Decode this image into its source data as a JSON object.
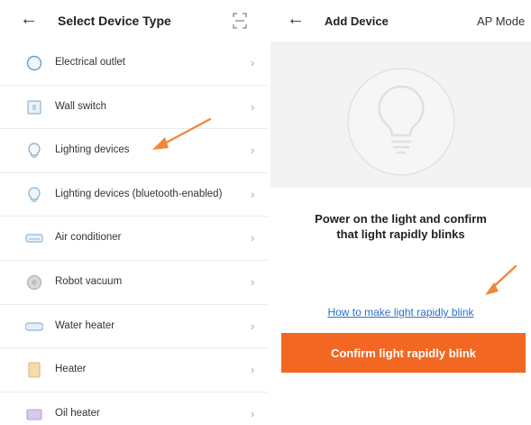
{
  "left": {
    "title": "Select Device Type",
    "items": [
      {
        "label": "Electrical outlet",
        "icon": "outlet-icon"
      },
      {
        "label": "Wall switch",
        "icon": "wall-switch-icon"
      },
      {
        "label": "Lighting devices",
        "icon": "bulb-icon"
      },
      {
        "label": "Lighting devices (bluetooth-enabled)",
        "icon": "bluetooth-bulb-icon"
      },
      {
        "label": "Air conditioner",
        "icon": "air-conditioner-icon"
      },
      {
        "label": "Robot vacuum",
        "icon": "robot-vacuum-icon"
      },
      {
        "label": "Water heater",
        "icon": "water-heater-icon"
      },
      {
        "label": "Heater",
        "icon": "heater-icon"
      },
      {
        "label": "Oil heater",
        "icon": "oil-heater-icon"
      }
    ]
  },
  "right": {
    "title": "Add Device",
    "mode": "AP Mode",
    "instruction_line1": "Power on the light and confirm",
    "instruction_line2": "that light rapidly blinks",
    "help_link": "How to make light rapidly blink",
    "confirm_label": "Confirm light rapidly blink"
  },
  "colors": {
    "accent": "#f26722",
    "link": "#2a72c9",
    "annotation_arrow": "#f0883c"
  }
}
